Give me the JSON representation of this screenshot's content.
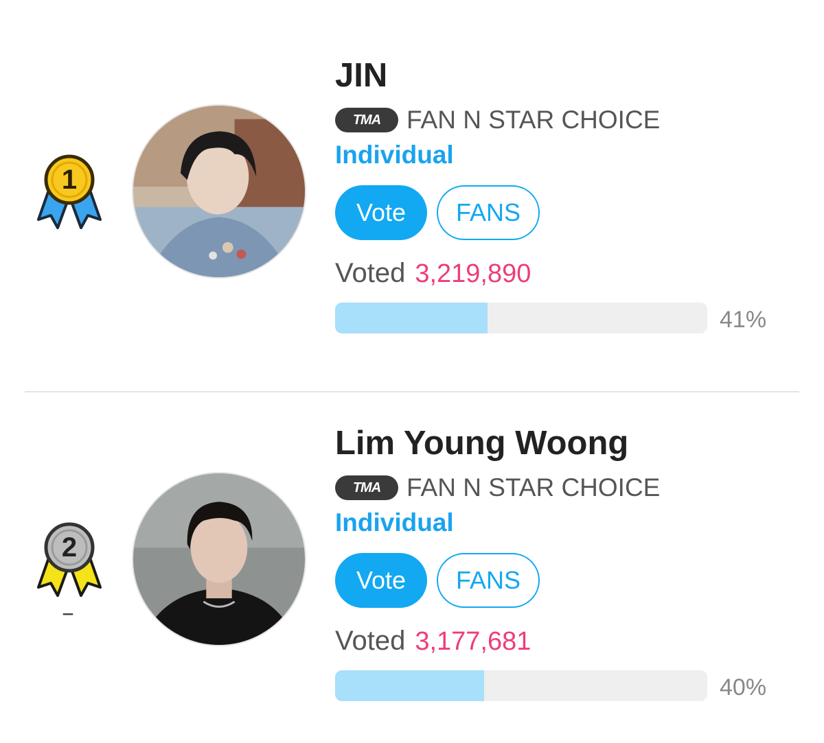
{
  "entries": [
    {
      "rank": 1,
      "rank_change": "",
      "medal_colors": {
        "coin": "#f7c81f",
        "coin_edge": "#3a2c00",
        "ribbon": "#3aa4ee"
      },
      "name": "JIN",
      "award_badge": "TMA",
      "award_name": "FAN N STAR CHOICE",
      "category": "Individual",
      "vote_label": "Vote",
      "fans_label": "FANS",
      "voted_label": "Voted",
      "voted_count": "3,219,890",
      "percent_value": 41,
      "percent_label": "41%"
    },
    {
      "rank": 2,
      "rank_change": "–",
      "medal_colors": {
        "coin": "#bdbdbd",
        "coin_edge": "#333333",
        "ribbon": "#f4e21a"
      },
      "name": "Lim Young Woong",
      "award_badge": "TMA",
      "award_name": "FAN N STAR CHOICE",
      "category": "Individual",
      "vote_label": "Vote",
      "fans_label": "FANS",
      "voted_label": "Voted",
      "voted_count": "3,177,681",
      "percent_value": 40,
      "percent_label": "40%"
    }
  ],
  "colors": {
    "accent_blue": "#12a8f2",
    "vote_count_pink": "#ee3d78",
    "progress_fill": "#a8dffb",
    "progress_track": "#efefef"
  }
}
